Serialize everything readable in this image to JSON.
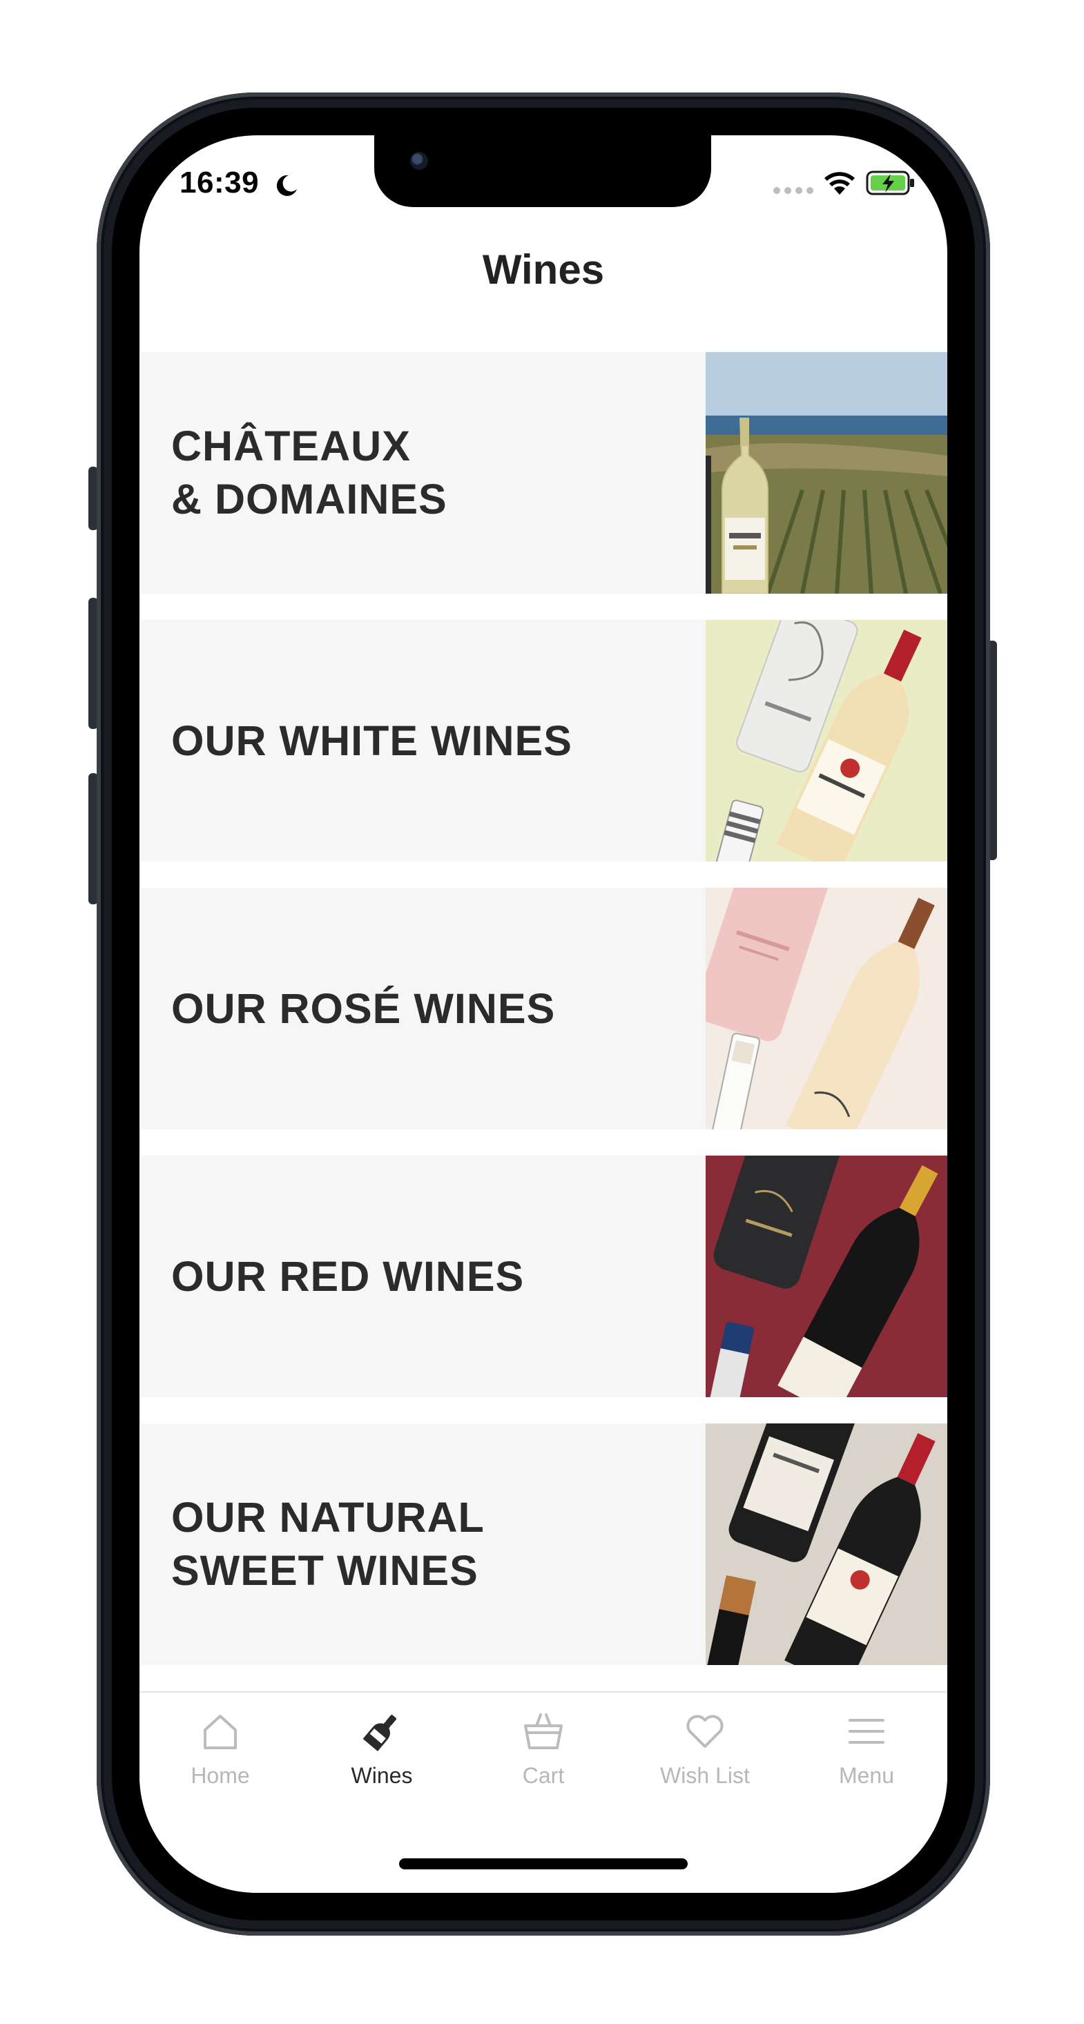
{
  "status_bar": {
    "time": "16:39",
    "icons": [
      "moon-icon",
      "signal-dots-icon",
      "wifi-icon",
      "battery-charging-icon"
    ],
    "battery_color": "#65d04a"
  },
  "header": {
    "title": "Wines"
  },
  "categories": [
    {
      "label": "CHÂTEAUX\n& DOMAINES",
      "thumb": "vineyard-sea-bottle"
    },
    {
      "label": "OUR WHITE WINES",
      "thumb": "white-wine-bottles"
    },
    {
      "label": "OUR ROSÉ WINES",
      "thumb": "rose-wine-bottles"
    },
    {
      "label": "OUR RED WINES",
      "thumb": "red-wine-bottles"
    },
    {
      "label": "OUR NATURAL\nSWEET WINES",
      "thumb": "sweet-wine-bottles"
    }
  ],
  "tab_bar": {
    "items": [
      {
        "label": "Home",
        "icon": "home-icon",
        "active": false
      },
      {
        "label": "Wines",
        "icon": "wine-bottle-icon",
        "active": true
      },
      {
        "label": "Cart",
        "icon": "basket-icon",
        "active": false
      },
      {
        "label": "Wish List",
        "icon": "heart-icon",
        "active": false
      },
      {
        "label": "Menu",
        "icon": "menu-icon",
        "active": false
      }
    ],
    "active_color": "#2a2a2a",
    "inactive_color": "#b7b7b7"
  }
}
